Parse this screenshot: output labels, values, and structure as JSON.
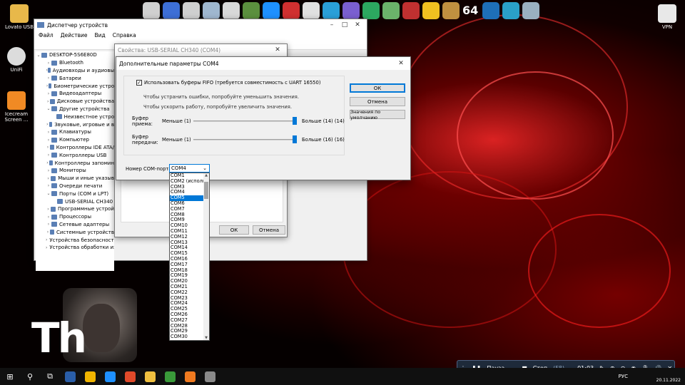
{
  "desktop": {
    "icons": [
      {
        "label": "Lovato USB",
        "color": "#e8b84a"
      },
      {
        "label": "UniFi",
        "color": "#dcdcdc"
      },
      {
        "label": "Icecream Screen ...",
        "color": "#f08a24"
      },
      {
        "label": "VPN",
        "color": "#e8e8e8"
      }
    ],
    "top_icon_colors": [
      "#d0d0d0",
      "#3d6fd6",
      "#cfcfcf",
      "#9fb7cf",
      "#d8d8d8",
      "#5b8f3e",
      "#1e90ff",
      "#d03030",
      "#e0e0e0",
      "#2a9fd8",
      "#7a5fd0",
      "#2ca860",
      "#6bb36a",
      "#c03030",
      "#f0c020",
      "#c09040",
      "#ffffff",
      "#1e6fb8",
      "#2aa0c8",
      "#9ab0c0"
    ],
    "top_icon_text": "64",
    "overlay_text": "Th"
  },
  "device_manager": {
    "title": "Диспетчер устройств",
    "menu": [
      "Файл",
      "Действие",
      "Вид",
      "Справка"
    ],
    "tree": [
      {
        "label": "DESKTOP-5S6E80D",
        "level": 0,
        "arrow": "⌄"
      },
      {
        "label": "Bluetooth",
        "level": 1,
        "arrow": "›"
      },
      {
        "label": "Аудиовходы и аудиовы",
        "level": 1,
        "arrow": "›"
      },
      {
        "label": "Батареи",
        "level": 1,
        "arrow": "›"
      },
      {
        "label": "Биометрические устро",
        "level": 1,
        "arrow": "›"
      },
      {
        "label": "Видеоадаптеры",
        "level": 1,
        "arrow": "›"
      },
      {
        "label": "Дисковые устройства",
        "level": 1,
        "arrow": "›"
      },
      {
        "label": "Другие устройства",
        "level": 1,
        "arrow": "⌄"
      },
      {
        "label": "Неизвестное устро",
        "level": 2,
        "arrow": ""
      },
      {
        "label": "Звуковые, игровые и в",
        "level": 1,
        "arrow": "›"
      },
      {
        "label": "Клавиатуры",
        "level": 1,
        "arrow": "›"
      },
      {
        "label": "Компьютер",
        "level": 1,
        "arrow": "›"
      },
      {
        "label": "Контроллеры IDE ATA/",
        "level": 1,
        "arrow": "›"
      },
      {
        "label": "Контроллеры USB",
        "level": 1,
        "arrow": "›"
      },
      {
        "label": "Контроллеры запомин",
        "level": 1,
        "arrow": "›"
      },
      {
        "label": "Мониторы",
        "level": 1,
        "arrow": "›"
      },
      {
        "label": "Мыши и иные указыв",
        "level": 1,
        "arrow": "›"
      },
      {
        "label": "Очереди печати",
        "level": 1,
        "arrow": "›"
      },
      {
        "label": "Порты (COM и LPT)",
        "level": 1,
        "arrow": "⌄"
      },
      {
        "label": "USB-SERIAL CH340",
        "level": 2,
        "arrow": ""
      },
      {
        "label": "Программные устрой",
        "level": 1,
        "arrow": "›"
      },
      {
        "label": "Процессоры",
        "level": 1,
        "arrow": "›"
      },
      {
        "label": "Сетевые адаптеры",
        "level": 1,
        "arrow": "›"
      },
      {
        "label": "Системные устройств",
        "level": 1,
        "arrow": "›"
      },
      {
        "label": "Устройства безопасности",
        "level": 1,
        "arrow": "›"
      },
      {
        "label": "Устройства обработки изображений",
        "level": 1,
        "arrow": "›"
      }
    ]
  },
  "properties_window": {
    "title": "Свойства: USB-SERIAL CH340 (COM4)",
    "ok": "ОК",
    "cancel": "Отмена"
  },
  "advanced_dialog": {
    "title": "Дополнительные параметры COM4",
    "fifo_label": "Использовать буферы FIFO (требуется совместимость с UART 16550)",
    "fifo_checked": "✓",
    "hint_errors": "Чтобы устранить ошибки, попробуйте уменьшить значения.",
    "hint_speed": "Чтобы ускорить работу, попробуйте увеличить значения.",
    "rx_label_1": "Буфер",
    "rx_label_2": "приема:",
    "tx_label_1": "Буфер",
    "tx_label_2": "передачи:",
    "rx_min": "Меньше (1)",
    "rx_max": "Больше (14) (14)",
    "rx_level": 1.0,
    "tx_min": "Меньше (1)",
    "tx_max": "Больше (16) (16)",
    "tx_level": 1.0,
    "com_label": "Номер COM-порта:",
    "com_value": "COM4",
    "ok": "ОК",
    "cancel": "Отмена",
    "defaults": "Значения по умолчанию",
    "options": [
      "COM1",
      "COM2 (исполь",
      "COM3",
      "COM4",
      "COM5",
      "COM6",
      "COM7",
      "COM8",
      "COM9",
      "COM10",
      "COM11",
      "COM12",
      "COM13",
      "COM14",
      "COM15",
      "COM16",
      "COM17",
      "COM18",
      "COM19",
      "COM20",
      "COM21",
      "COM22",
      "COM23",
      "COM24",
      "COM25",
      "COM26",
      "COM27",
      "COM28",
      "COM29",
      "COM30"
    ],
    "highlighted": "COM5"
  },
  "recorder": {
    "pause": "Пауза",
    "stop": "Стоп",
    "stop_key": "(F8)",
    "time": "01:03"
  },
  "taskbar": {
    "app_colors": [
      "#2a5ea8",
      "#f0b400",
      "#1e90ff",
      "#e04a2a",
      "#f0c040",
      "#3a9a3a",
      "#f07a20",
      "#8a8a8a"
    ],
    "lang": "РУС",
    "date": "20.11.2022"
  }
}
